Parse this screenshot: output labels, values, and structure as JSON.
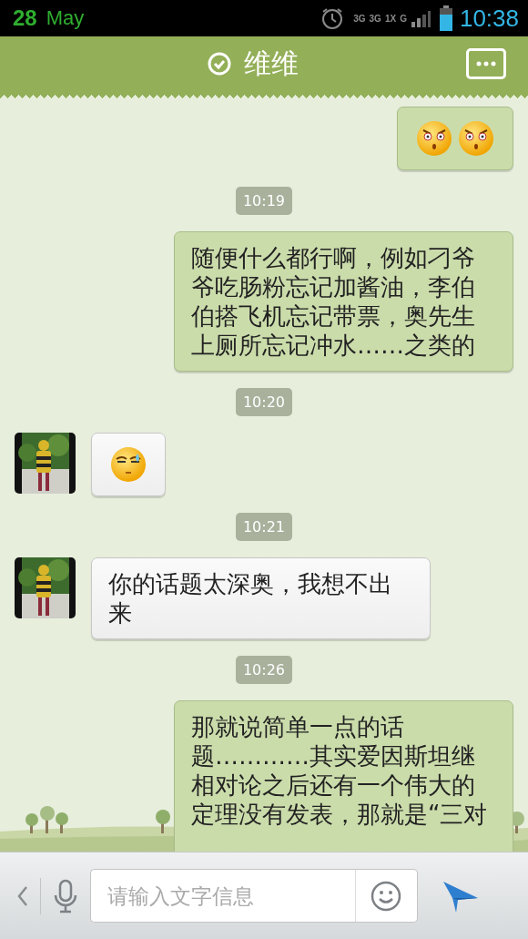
{
  "status_bar": {
    "day": "28",
    "month": "May",
    "network_labels": [
      "3G",
      "3G",
      "1X",
      "G"
    ],
    "time": "10:38"
  },
  "header": {
    "title": "维维"
  },
  "messages": [
    {
      "kind": "emoji",
      "outgoing": true,
      "faces": [
        {
          "kind": "frown"
        },
        {
          "kind": "frown"
        }
      ]
    },
    {
      "kind": "time",
      "text": "10:19"
    },
    {
      "kind": "text",
      "outgoing": true,
      "text": "随便什么都行啊，例如刁爷爷吃肠粉忘记加酱油，李伯伯搭飞机忘记带票，奥先生上厕所忘记冲水……之类的"
    },
    {
      "kind": "time",
      "text": "10:20"
    },
    {
      "kind": "emoji",
      "outgoing": false,
      "faces": [
        {
          "kind": "sweat"
        }
      ]
    },
    {
      "kind": "time",
      "text": "10:21"
    },
    {
      "kind": "text",
      "outgoing": false,
      "text": "你的话题太深奥，我想不出来"
    },
    {
      "kind": "time",
      "text": "10:26"
    },
    {
      "kind": "text",
      "outgoing": true,
      "text": "那就说简单一点的话题…………其实爱因斯坦继相对论之后还有一个伟大的定理没有发表，那就是“三对"
    }
  ],
  "composer": {
    "placeholder": "请输入文字信息"
  }
}
